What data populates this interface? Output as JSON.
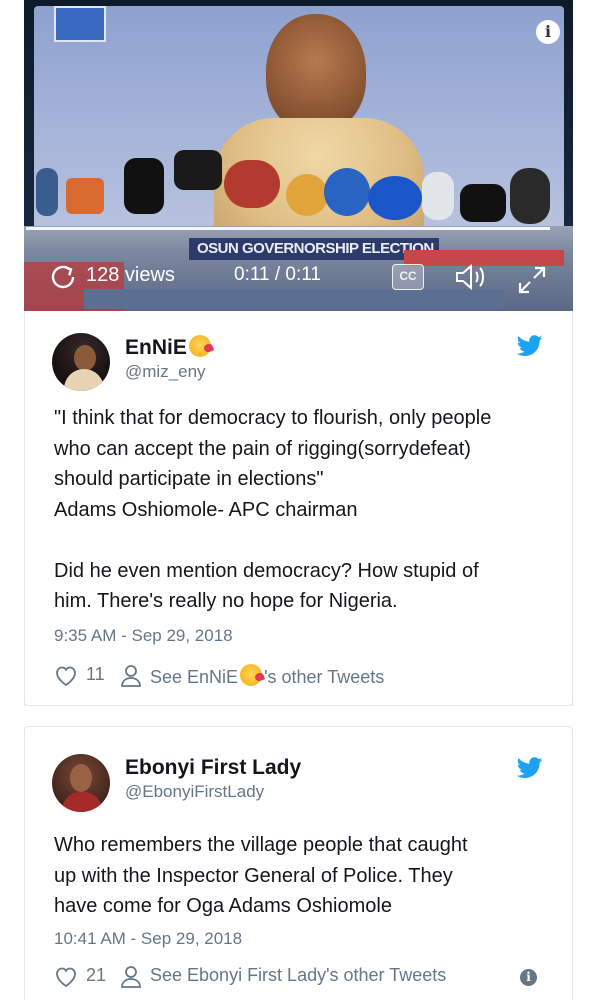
{
  "video": {
    "views": "128 views",
    "time": "0:11 / 0:11",
    "cc_label": "CC",
    "banner_text": "OSUN GOVERNORSHIP ELECTION",
    "info_glyph": "i"
  },
  "tweets": [
    {
      "name": "EnNiE",
      "handle": "@miz_eny",
      "lines": [
        "\"I think that for democracy to flourish, only people",
        "who can accept the pain of rigging(sorrydefeat)",
        "should participate in elections\"",
        "Adams Oshiomole- APC chairman",
        "",
        "Did he even mention democracy? How stupid of",
        "him.  There's really no hope for Nigeria."
      ],
      "timestamp": "9:35 AM - Sep 29, 2018",
      "likes": "11",
      "other_prefix": "See EnNiE",
      "other_suffix": "'s other Tweets"
    },
    {
      "name": "Ebonyi First Lady",
      "handle": "@EbonyiFirstLady",
      "lines": [
        "Who remembers the village people that caught",
        "up with the Inspector General of Police. They",
        "have come for Oga Adams Oshiomole"
      ],
      "timestamp": "10:41 AM - Sep 29, 2018",
      "likes": "21",
      "other_tweets": "See Ebonyi First Lady's other Tweets",
      "info_glyph": "i"
    }
  ],
  "icons": {
    "replay": "replay-icon",
    "volume": "volume-icon",
    "fullscreen": "fullscreen-icon",
    "twitter": "twitter-bird-icon",
    "heart": "heart-icon",
    "person": "person-icon",
    "emoji": "kissing-heart-emoji-icon"
  },
  "colors": {
    "twitter_blue": "#1da1f2",
    "secondary_text": "#657786",
    "primary_text": "#14171a",
    "border": "#e1e8ed"
  }
}
